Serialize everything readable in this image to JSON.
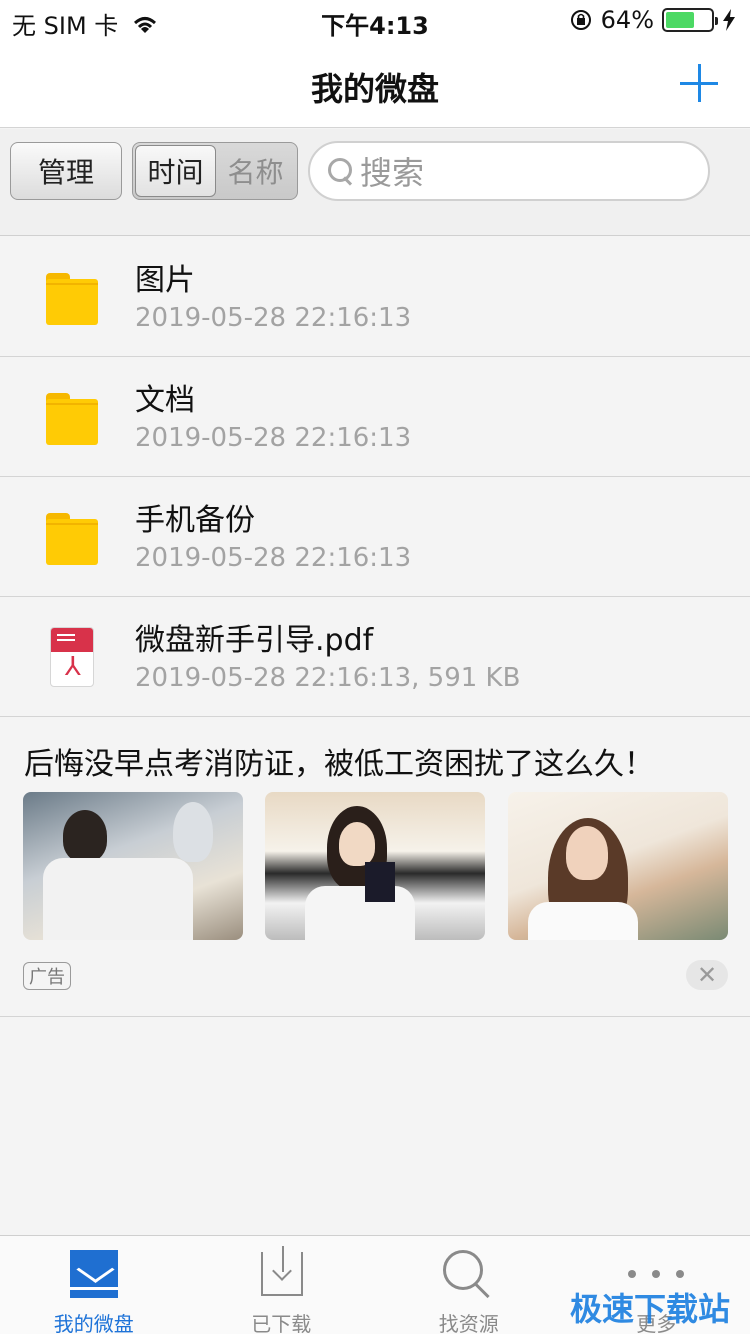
{
  "status_bar": {
    "carrier": "无 SIM 卡",
    "time": "下午4:13",
    "battery": "64%",
    "battery_level": 0.64
  },
  "nav": {
    "title": "我的微盘"
  },
  "toolbar": {
    "manage": "管理",
    "sort_options": [
      "时间",
      "名称"
    ],
    "sort_selected": "时间",
    "search_placeholder": "搜索"
  },
  "files": [
    {
      "name": "图片",
      "meta": "2019-05-28 22:16:13",
      "type": "folder"
    },
    {
      "name": "文档",
      "meta": "2019-05-28 22:16:13",
      "type": "folder"
    },
    {
      "name": "手机备份",
      "meta": "2019-05-28 22:16:13",
      "type": "folder"
    },
    {
      "name": "微盘新手引导.pdf",
      "meta": "2019-05-28 22:16:13, 591 KB",
      "type": "pdf"
    }
  ],
  "ad": {
    "headline": "后悔没早点考消防证，被低工资困扰了这么久！",
    "tag": "广告",
    "close": "✕"
  },
  "tabbar": {
    "items": [
      "我的微盘",
      "已下载",
      "找资源",
      "更多"
    ],
    "active": "我的微盘"
  },
  "watermark": "极速下载站",
  "colors": {
    "accent": "#1e73d8",
    "folder": "#ffcb05",
    "pdf": "#d8324a"
  }
}
